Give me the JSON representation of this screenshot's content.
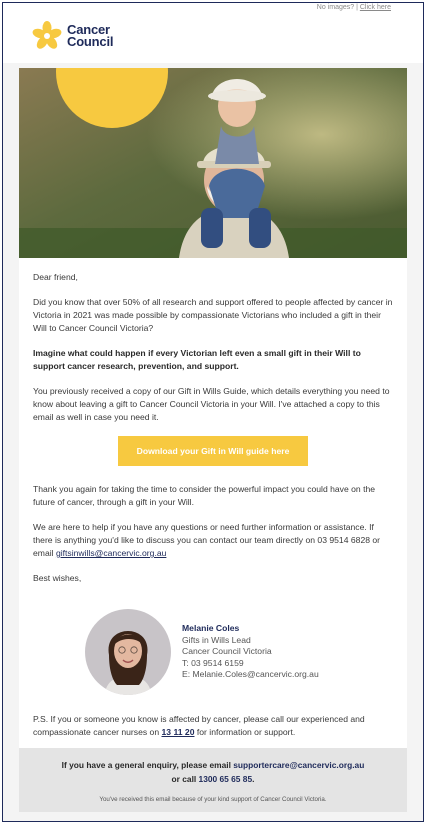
{
  "header": {
    "no_images_text": "No images?",
    "click_here": "Click here",
    "logo_line1": "Cancer",
    "logo_line2": "Council"
  },
  "hero": {
    "image": "grandfather-with-grandchild-photo"
  },
  "body": {
    "greeting": "Dear friend,",
    "para1": "Did you know that over 50% of all research and support offered to people affected by cancer in Victoria in 2021 was made possible by compassionate Victorians who included a gift in their Will to Cancer Council Victoria?",
    "para2": "Imagine what could happen if every Victorian left even a small gift in their Will to support cancer research, prevention, and support.",
    "para3": "You previously received a copy of our Gift in Wills Guide, which details everything you need to know about leaving a gift to Cancer Council Victoria in your Will. I've attached a copy to this email as well in case you need it.",
    "download_button": "Download your Gift in Will guide here",
    "para4": "Thank you again for taking the time to consider the powerful impact you could have on the future of cancer, through a gift in your Will.",
    "para5_before": "We are here to help if you have any questions or need further information or assistance. If there is anything you'd like to discuss you can contact our team directly on 03 9514 6828 or email ",
    "para5_email": "giftsinwills@cancervic.org.au",
    "signoff": "Best wishes,"
  },
  "signature": {
    "name": "Melanie Coles",
    "title": "Gifts in Wills Lead",
    "org": "Cancer Council Victoria",
    "phone": "T: 03 9514 6159",
    "email": "E: Melanie.Coles@cancervic.org.au"
  },
  "ps": {
    "before": "P.S. If you or someone you know is affected by cancer, please call our experienced and compassionate cancer nurses on ",
    "phone": "13 11 20",
    "after": " for information or support."
  },
  "footer": {
    "line1": "If you have a general enquiry, please email ",
    "email": "supportercare@cancervic.org.au",
    "line2": "or call ",
    "phone": "1300 65 65 85",
    "line2_end": ".",
    "note": "You've received this email because of your kind support of Cancer Council Victoria."
  },
  "colors": {
    "brand_navy": "#1e2a5a",
    "brand_yellow": "#f7c940",
    "footer_grey": "#e4e4e4"
  }
}
